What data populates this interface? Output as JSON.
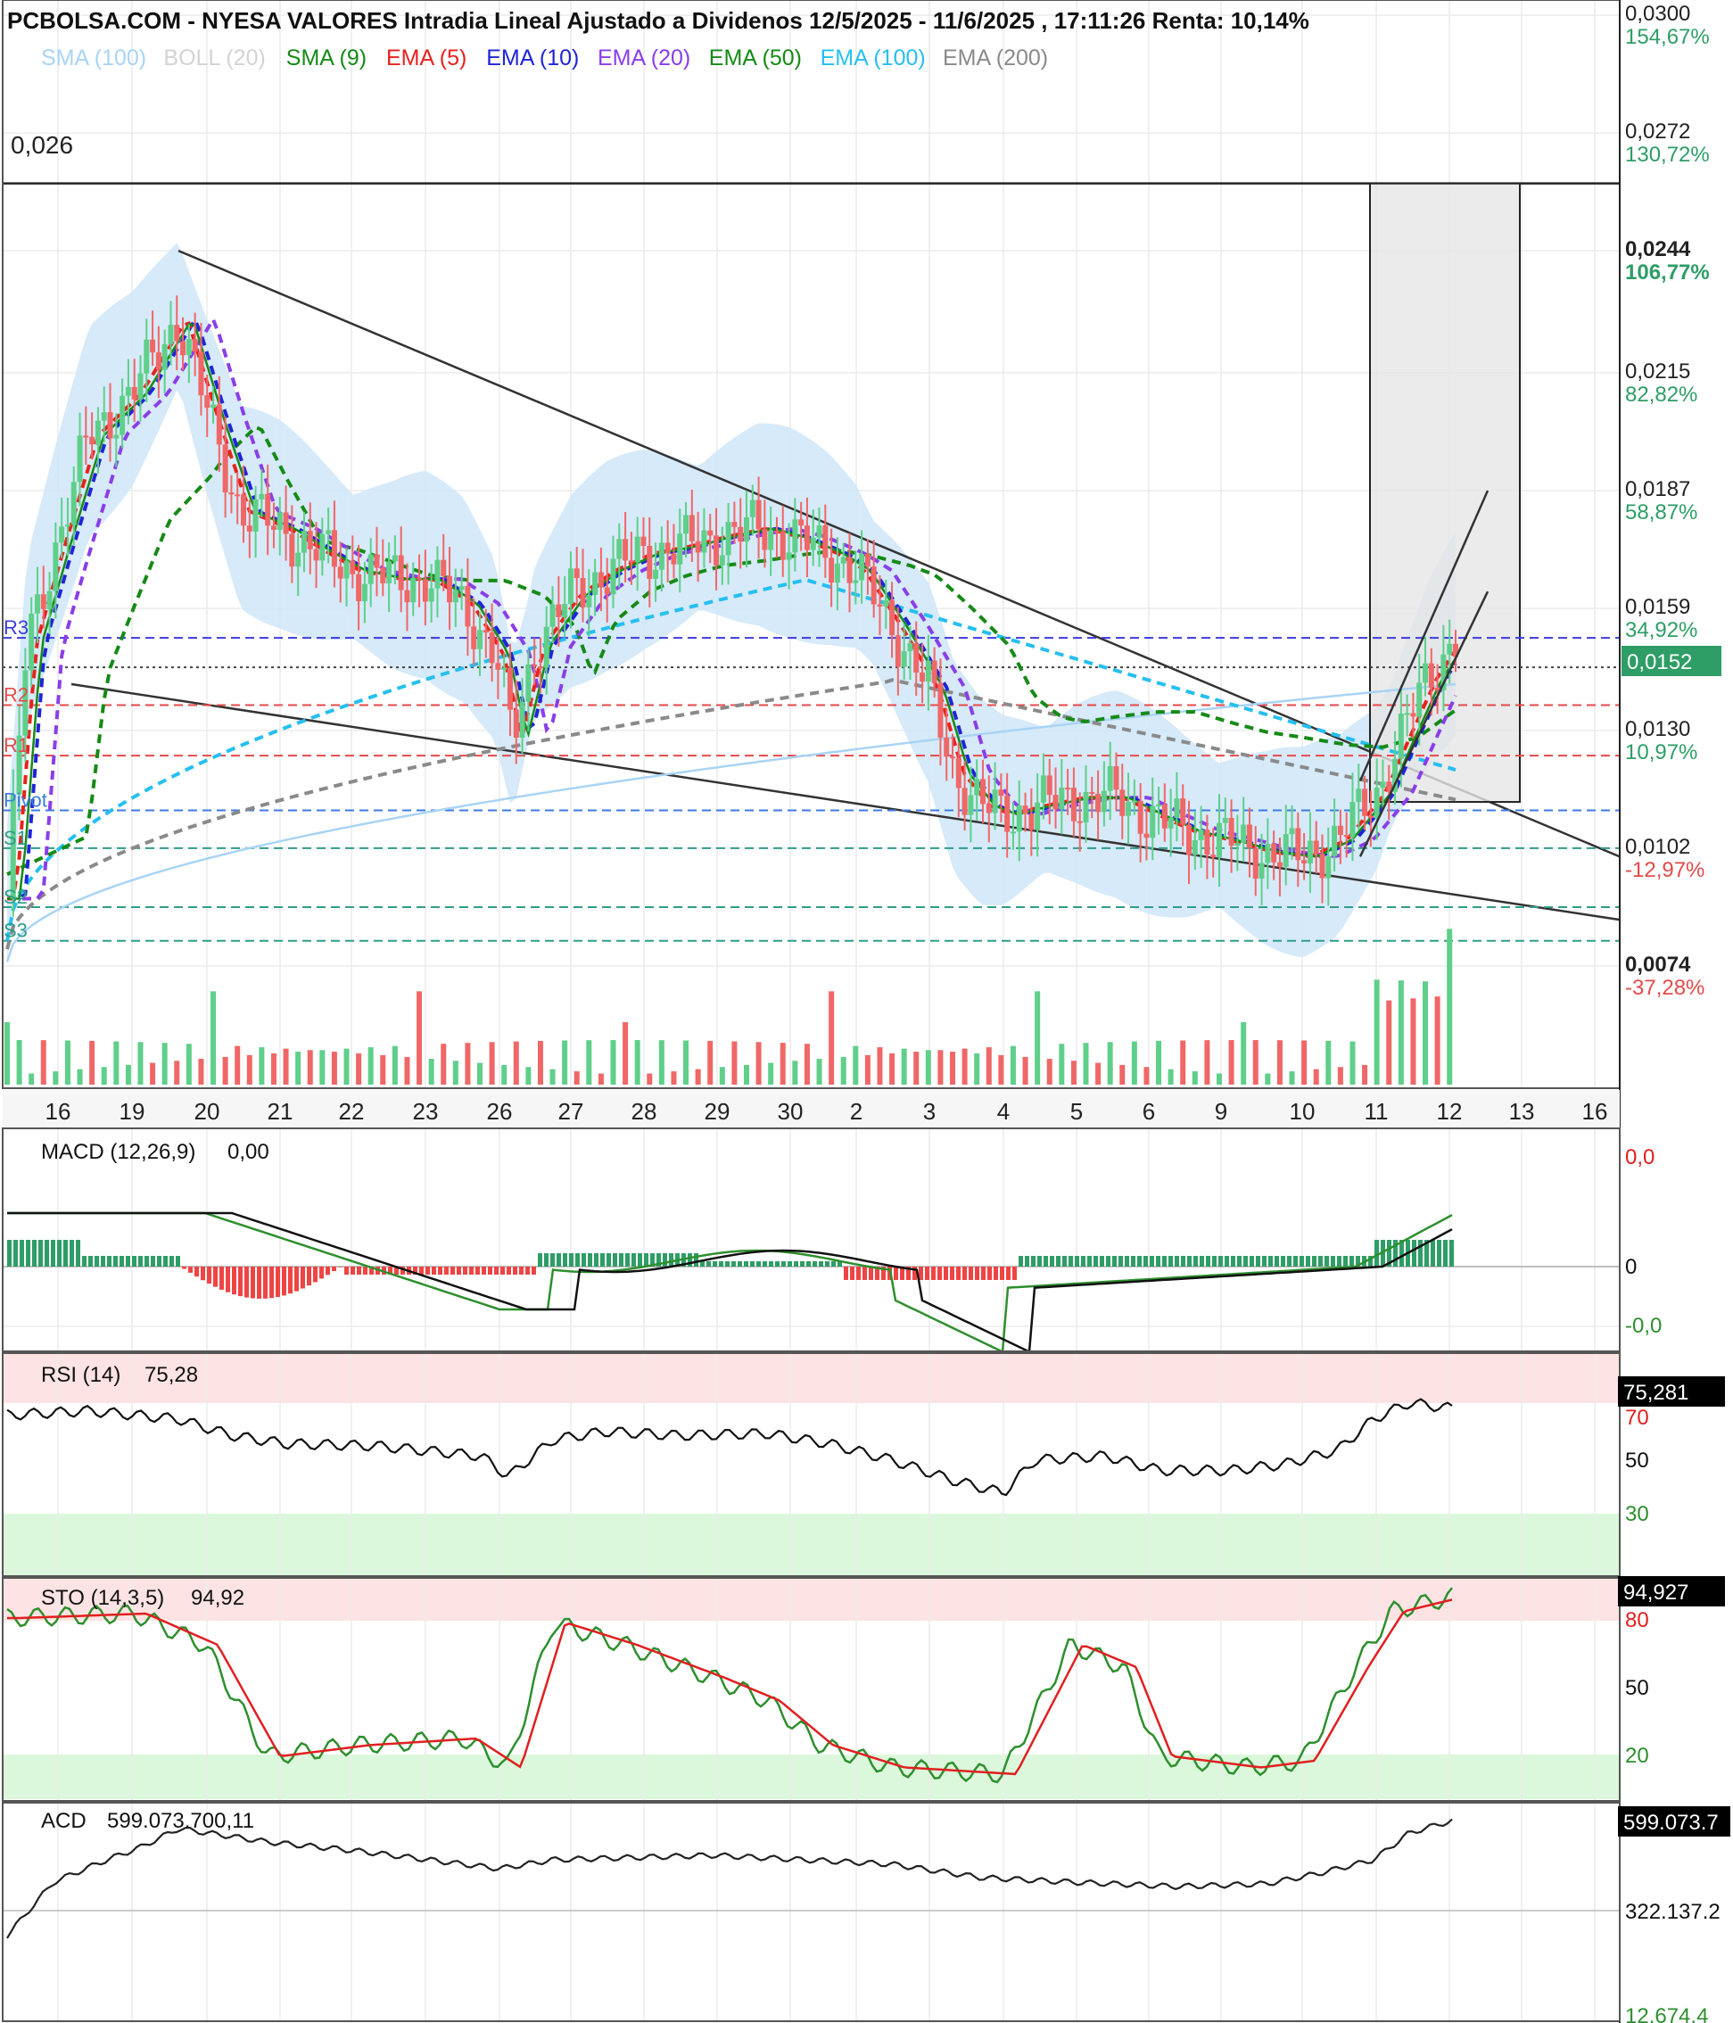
{
  "header": {
    "title": "PCBOLSA.COM - NYESA VALORES Intradia Lineal Ajustado a Dividenos 12/5/2025 - 11/6/2025 , 17:11:26 Renta: 10,14%"
  },
  "legend": [
    {
      "label": "SMA (100)",
      "color": "#a9d4f5"
    },
    {
      "label": "BOLL (20)",
      "color": "#d3d3d3"
    },
    {
      "label": "SMA (9)",
      "color": "#168a16"
    },
    {
      "label": "EMA (5)",
      "color": "#e8221e"
    },
    {
      "label": "EMA (10)",
      "color": "#1f24d8"
    },
    {
      "label": "EMA (20)",
      "color": "#8a3ee8"
    },
    {
      "label": "EMA (50)",
      "color": "#168a16"
    },
    {
      "label": "EMA (100)",
      "color": "#26bff0"
    },
    {
      "label": "EMA (200)",
      "color": "#8a8a8a"
    }
  ],
  "colors": {
    "up": "#5fcf8a",
    "down": "#f06767",
    "boll_fill": "#cfe6f8",
    "last_price_box": "#2e9d66",
    "axis_price": "#222222",
    "axis_pct_pos": "#2e9d66",
    "axis_pct_neg": "#e64a4a"
  },
  "annotations": {
    "resistance_label": "0,026",
    "pivot_labels": [
      "R3",
      "R2",
      "R1",
      "Pivot",
      "S1",
      "S2",
      "S3"
    ]
  },
  "right_axis": {
    "prices": [
      "0,0300",
      "0,0272",
      "0,0244",
      "0,0215",
      "0,0187",
      "0,0159",
      "0,0130",
      "0,0102",
      "0,0074"
    ],
    "percents": [
      "154,67%",
      "130,72%",
      "106,77%",
      "82,82%",
      "58,87%",
      "34,92%",
      "10,97%",
      "-12,97%",
      "-37,28%"
    ],
    "last_price": "0,0152"
  },
  "x_axis": {
    "labels": [
      "16",
      "19",
      "20",
      "21",
      "22",
      "23",
      "26",
      "27",
      "28",
      "29",
      "30",
      "2",
      "3",
      "4",
      "5",
      "6",
      "9",
      "10",
      "11",
      "12",
      "13",
      "16"
    ]
  },
  "panels": {
    "macd": {
      "title": "MACD (12,26,9)",
      "value": "0,00",
      "axis": [
        "0,0",
        "0",
        "-0,0"
      ]
    },
    "rsi": {
      "title": "RSI (14)",
      "value": "75,28",
      "axis_box": "75,281",
      "axis": [
        "70",
        "50",
        "30"
      ]
    },
    "sto": {
      "title": "STO (14,3,5)",
      "value": "94,92",
      "axis_box": "94,927",
      "axis": [
        "80",
        "50",
        "20"
      ]
    },
    "acd": {
      "title": "ACD",
      "value": "599.073.700,11",
      "axis_box": "599.073.7",
      "axis": [
        "322.137.2",
        "12.674.4"
      ]
    }
  },
  "chart_data": [
    {
      "type": "candlestick",
      "title": "PCBOLSA.COM - NYESA VALORES Intradia Lineal Ajustado a Dividenos 12/5/2025 - 11/6/2025 , 17:11:26 Renta: 10,14%",
      "x_categories": [
        "16",
        "19",
        "20",
        "21",
        "22",
        "23",
        "26",
        "27",
        "28",
        "29",
        "30",
        "2",
        "3",
        "4",
        "5",
        "6",
        "9",
        "10",
        "11",
        "12"
      ],
      "ylim": [
        0.0068,
        0.03
      ],
      "close_by_day": [
        0.015,
        0.0205,
        0.0215,
        0.018,
        0.0172,
        0.0166,
        0.0146,
        0.0168,
        0.0172,
        0.0178,
        0.0174,
        0.0168,
        0.0126,
        0.0116,
        0.0117,
        0.0112,
        0.0106,
        0.01,
        0.0118,
        0.0152
      ],
      "resistance": 0.026,
      "pivots": {
        "R3": 0.0152,
        "R2": 0.0136,
        "R1": 0.0124,
        "Pivot": 0.0111,
        "S1": 0.0102,
        "S2": 0.0088,
        "S3": 0.008
      },
      "last_price": 0.0152,
      "indicators": [
        "SMA (100)",
        "BOLL (20)",
        "SMA (9)",
        "EMA (5)",
        "EMA (10)",
        "EMA (20)",
        "EMA (50)",
        "EMA (100)",
        "EMA (200)"
      ]
    },
    {
      "type": "line",
      "title": "MACD (12,26,9)",
      "value": 0.0
    },
    {
      "type": "line",
      "title": "RSI (14)",
      "value": 75.28,
      "ylim": [
        0,
        100
      ],
      "bands": [
        30,
        70
      ]
    },
    {
      "type": "line",
      "title": "STO (14,3,5)",
      "value": 94.92,
      "ylim": [
        0,
        100
      ],
      "bands": [
        20,
        80
      ]
    },
    {
      "type": "line",
      "title": "ACD",
      "value": 599073700.11
    }
  ]
}
